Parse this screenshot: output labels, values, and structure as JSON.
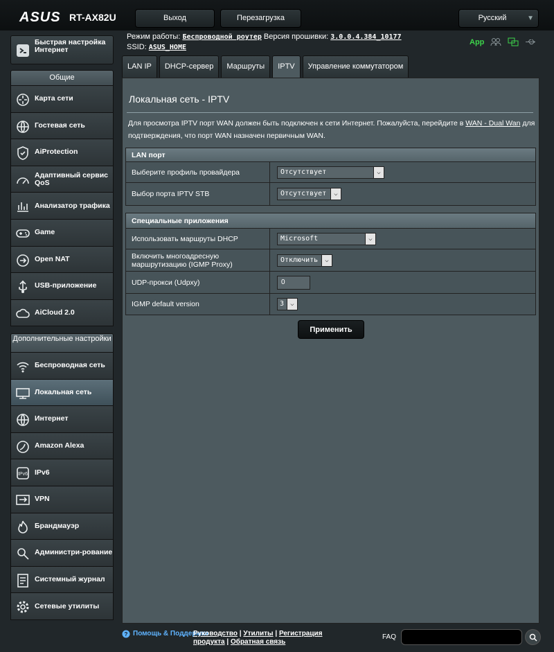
{
  "brand": {
    "logo": "ASUS",
    "model": "RT-AX82U"
  },
  "topbar": {
    "logout_label": "Выход",
    "reboot_label": "Перезагрузка",
    "language": "Русский"
  },
  "status": {
    "mode_label": "Режим работы:",
    "mode_value": "Беспроводной роутер",
    "firmware_label": "Версия прошивки:",
    "firmware_value": "3.0.0.4.384_10177",
    "ssid_label": "SSID:",
    "ssid_value": "ASUS_HOME",
    "app_label": "App"
  },
  "sidebar": {
    "quick_setup": "Быстрая настройка Интернет",
    "general_header": "Общие",
    "general_items": [
      {
        "label": "Карта сети",
        "icon": "network-map-icon"
      },
      {
        "label": "Гостевая сеть",
        "icon": "guest-network-icon"
      },
      {
        "label": "AiProtection",
        "icon": "aiprotection-icon"
      },
      {
        "label": "Адаптивный сервис QoS",
        "icon": "qos-icon"
      },
      {
        "label": "Анализатор трафика",
        "icon": "traffic-analyzer-icon"
      },
      {
        "label": "Game",
        "icon": "gamepad-icon"
      },
      {
        "label": "Open NAT",
        "icon": "open-nat-icon"
      },
      {
        "label": "USB-приложение",
        "icon": "usb-icon"
      },
      {
        "label": "AiCloud 2.0",
        "icon": "cloud-icon"
      }
    ],
    "advanced_header": "Дополнительные настройки",
    "advanced_items": [
      {
        "label": "Беспроводная сеть",
        "icon": "wireless-icon"
      },
      {
        "label": "Локальная сеть",
        "icon": "lan-icon"
      },
      {
        "label": "Интернет",
        "icon": "globe-icon"
      },
      {
        "label": "Amazon Alexa",
        "icon": "alexa-icon"
      },
      {
        "label": "IPv6",
        "icon": "ipv6-icon"
      },
      {
        "label": "VPN",
        "icon": "vpn-icon"
      },
      {
        "label": "Брандмауэр",
        "icon": "firewall-icon"
      },
      {
        "label": "Администри-рование",
        "icon": "admin-icon"
      },
      {
        "label": "Системный журнал",
        "icon": "syslog-icon"
      },
      {
        "label": "Сетевые утилиты",
        "icon": "gear-icon"
      }
    ],
    "active_item": "Локальная сеть"
  },
  "tabs": [
    "LAN IP",
    "DHCP-сервер",
    "Маршруты",
    "IPTV",
    "Управление коммутатором"
  ],
  "active_tab": "IPTV",
  "main": {
    "title": "Локальная сеть - IPTV",
    "description_pre": "Для просмотра IPTV порт WAN должен быть подключен к сети Интернет. Пожалуйста, перейдите в ",
    "description_link": "WAN - Dual Wan",
    "description_post": " для подтверждения, что порт WAN назначен первичным WAN.",
    "lan_section": {
      "title": "LAN порт",
      "provider_label": "Выберите профиль провайдера",
      "provider_value": "Отсутствует",
      "stb_label": "Выбор порта IPTV STB",
      "stb_value": "Отсутствует"
    },
    "special_section": {
      "title": "Специальные приложения",
      "dhcp_label": "Использовать маршруты DHCP",
      "dhcp_value": "Microsoft",
      "igmp_label": "Включить многоадресную маршрутизацию (IGMP Proxy)",
      "igmp_value": "Отключить",
      "udp_label": "UDP-прокси (Udpxy)",
      "udp_value": "0",
      "igmp_ver_label": "IGMP default version",
      "igmp_ver_value": "3"
    },
    "apply_label": "Применить"
  },
  "footer": {
    "help_label": "Помощь & Поддержка",
    "link_manual": "Руководство",
    "link_utilities": "Утилиты",
    "link_register": "Регистрация продукта",
    "link_feedback": "Обратная связь",
    "faq_label": "FAQ"
  },
  "colors": {
    "background": "#21272a",
    "panel": "#4d5a5f",
    "app_green": "#3dd44b",
    "active_menu": "#5c6f79"
  }
}
